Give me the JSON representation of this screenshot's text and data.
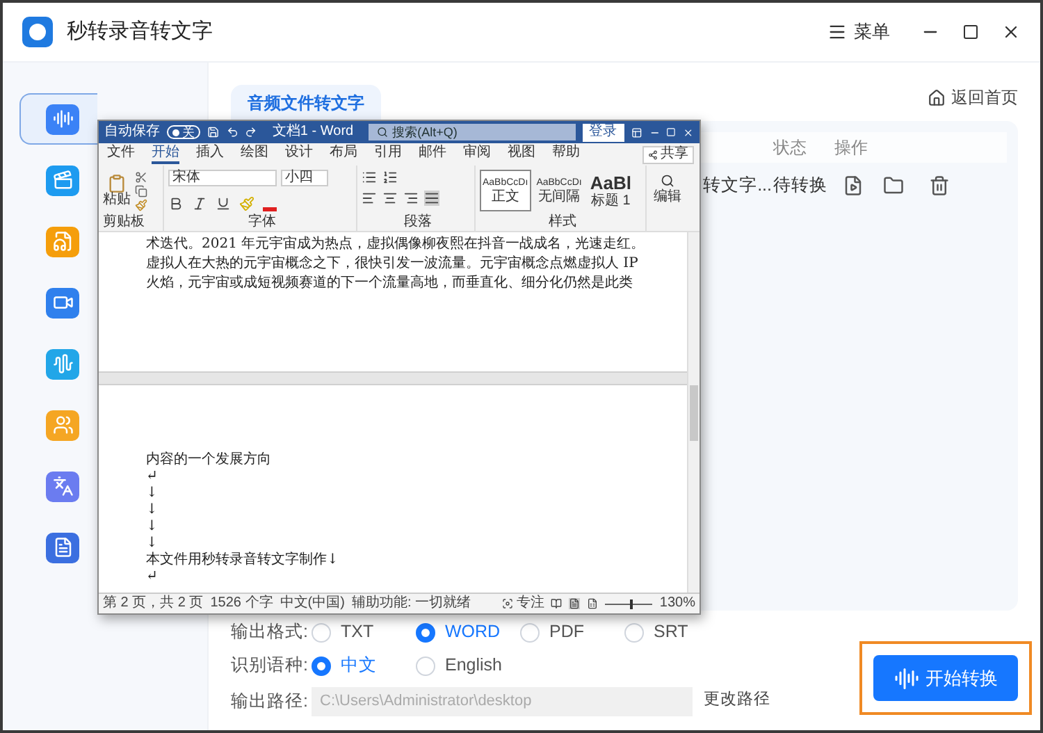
{
  "app": {
    "title": "秒转录音转文字",
    "menu_label": "菜单"
  },
  "sidebar": {
    "items": [
      {
        "selected": true,
        "color": "#3b82f6"
      },
      {
        "selected": false,
        "color": "#1d9bf0"
      },
      {
        "selected": false,
        "color": "#f59e0b"
      },
      {
        "selected": false,
        "color": "#2f80ed"
      },
      {
        "selected": false,
        "color": "#22a6e8"
      },
      {
        "selected": false,
        "color": "#f5a623"
      },
      {
        "selected": false,
        "color": "#6b7cf0"
      },
      {
        "selected": false,
        "color": "#3b6fe0"
      }
    ]
  },
  "tabs": [
    {
      "label": "音频文件转文字",
      "selected": true
    }
  ],
  "back_link": "返回首页",
  "table": {
    "columns": [
      "状态",
      "操作"
    ],
    "rows": [
      {
        "file_name": "转文字...",
        "status": "待转换"
      }
    ]
  },
  "options": {
    "format": {
      "label": "输出格式:",
      "choices": [
        {
          "label": "TXT",
          "selected": false
        },
        {
          "label": "WORD",
          "selected": true
        },
        {
          "label": "PDF",
          "selected": false
        },
        {
          "label": "SRT",
          "selected": false
        }
      ]
    },
    "language": {
      "label": "识别语种:",
      "choices": [
        {
          "label": "中文",
          "selected": true
        },
        {
          "label": "English",
          "selected": false
        }
      ]
    },
    "output_path": {
      "label": "输出路径:",
      "value": "C:\\Users\\Administrator\\desktop",
      "action": "更改路径"
    }
  },
  "start_button": {
    "label": "开始转换",
    "highlighted": true
  },
  "word_window": {
    "autosave_label": "自动保存",
    "autosave": {
      "on": false,
      "label": "关"
    },
    "title": "文档1 - Word",
    "search_placeholder": "搜索(Alt+Q)",
    "sign_in": "登录",
    "share": "共享",
    "ribbon_tabs": [
      {
        "label": "文件",
        "selected": false
      },
      {
        "label": "开始",
        "selected": true
      },
      {
        "label": "插入",
        "selected": false
      },
      {
        "label": "绘图",
        "selected": false
      },
      {
        "label": "设计",
        "selected": false
      },
      {
        "label": "布局",
        "selected": false
      },
      {
        "label": "引用",
        "selected": false
      },
      {
        "label": "邮件",
        "selected": false
      },
      {
        "label": "审阅",
        "selected": false
      },
      {
        "label": "视图",
        "selected": false
      },
      {
        "label": "帮助",
        "selected": false
      }
    ],
    "paste_label": "粘贴",
    "font_name": "宋体",
    "font_size": "小四",
    "styles": [
      {
        "preview": "AaBbCcDı",
        "name": "正文",
        "selected": true
      },
      {
        "preview": "AaBbCcDı",
        "name": "无间隔",
        "selected": false
      },
      {
        "preview": "AaBl",
        "name": "标题 1",
        "selected": false
      }
    ],
    "edit_label": "编辑",
    "group_labels": [
      "剪贴板",
      "字体",
      "段落",
      "样式"
    ],
    "page1_lines": [
      "术迭代。2021 年元宇宙成为热点，虚拟偶像柳夜熙在抖音一战成名，光速走红。",
      "虚拟人在大热的元宇宙概念之下，很快引发一波流量。元宇宙概念点燃虚拟人 IP",
      "火焰，元宇宙或成短视频赛道的下一个流量高地，而垂直化、细分化仍然是此类"
    ],
    "page2_lines": [
      "内容的一个发展方向",
      "↵",
      "↓",
      "↓",
      "↓",
      "↓",
      "本文件用秒转录音转文字制作↓",
      "↵"
    ],
    "status_items": [
      "第 2 页，共 2 页",
      "1526 个字",
      "中文(中国)",
      "辅助功能: 一切就绪"
    ],
    "focus_label": "专注",
    "zoom": {
      "label": "130%",
      "level": 0.55
    }
  }
}
